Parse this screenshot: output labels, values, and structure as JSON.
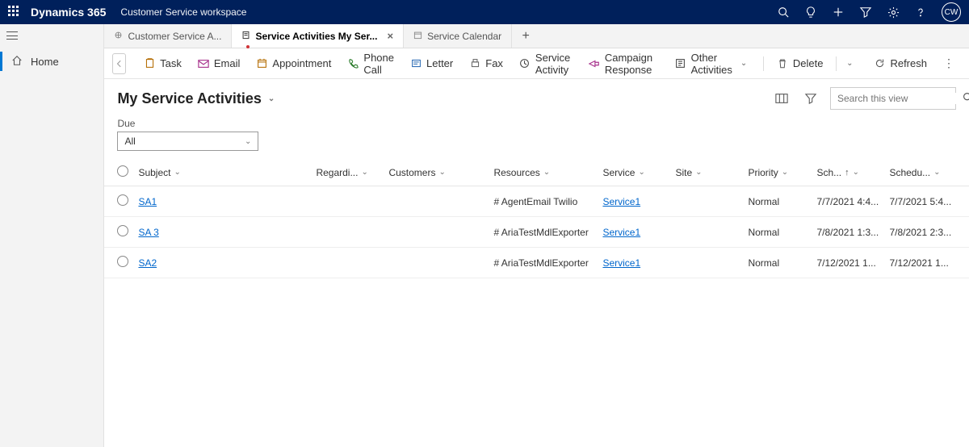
{
  "header": {
    "brand": "Dynamics 365",
    "workspace": "Customer Service workspace",
    "avatar_initials": "CW"
  },
  "sidebar": {
    "items": [
      {
        "label": "Home"
      }
    ]
  },
  "tabs": {
    "items": [
      {
        "label": "Customer Service A...",
        "active": false
      },
      {
        "label": "Service Activities My Ser...",
        "active": true
      },
      {
        "label": "Service Calendar",
        "active": false
      }
    ]
  },
  "commands": {
    "task": "Task",
    "email": "Email",
    "appointment": "Appointment",
    "phone_call": "Phone Call",
    "letter": "Letter",
    "fax": "Fax",
    "service_activity": "Service Activity",
    "campaign_response": "Campaign Response",
    "other_activities": "Other Activities",
    "delete": "Delete",
    "refresh": "Refresh"
  },
  "view": {
    "title": "My Service Activities",
    "search_placeholder": "Search this view"
  },
  "filter": {
    "label": "Due",
    "value": "All"
  },
  "grid": {
    "columns": {
      "subject": "Subject",
      "regarding": "Regardi...",
      "customers": "Customers",
      "resources": "Resources",
      "service": "Service",
      "site": "Site",
      "priority": "Priority",
      "scheduled_start": "Sch...",
      "scheduled_end": "Schedu..."
    },
    "rows": [
      {
        "subject": "SA1",
        "regarding": "",
        "customers": "",
        "resources": "# AgentEmail Twilio",
        "service": "Service1",
        "site": "",
        "priority": "Normal",
        "scheduled_start": "7/7/2021 4:4...",
        "scheduled_end": "7/7/2021 5:4..."
      },
      {
        "subject": "SA 3",
        "regarding": "",
        "customers": "",
        "resources": "# AriaTestMdlExporter",
        "service": "Service1",
        "site": "",
        "priority": "Normal",
        "scheduled_start": "7/8/2021 1:3...",
        "scheduled_end": "7/8/2021 2:3..."
      },
      {
        "subject": "SA2",
        "regarding": "",
        "customers": "",
        "resources": "# AriaTestMdlExporter",
        "service": "Service1",
        "site": "",
        "priority": "Normal",
        "scheduled_start": "7/12/2021 1...",
        "scheduled_end": "7/12/2021 1..."
      }
    ]
  }
}
